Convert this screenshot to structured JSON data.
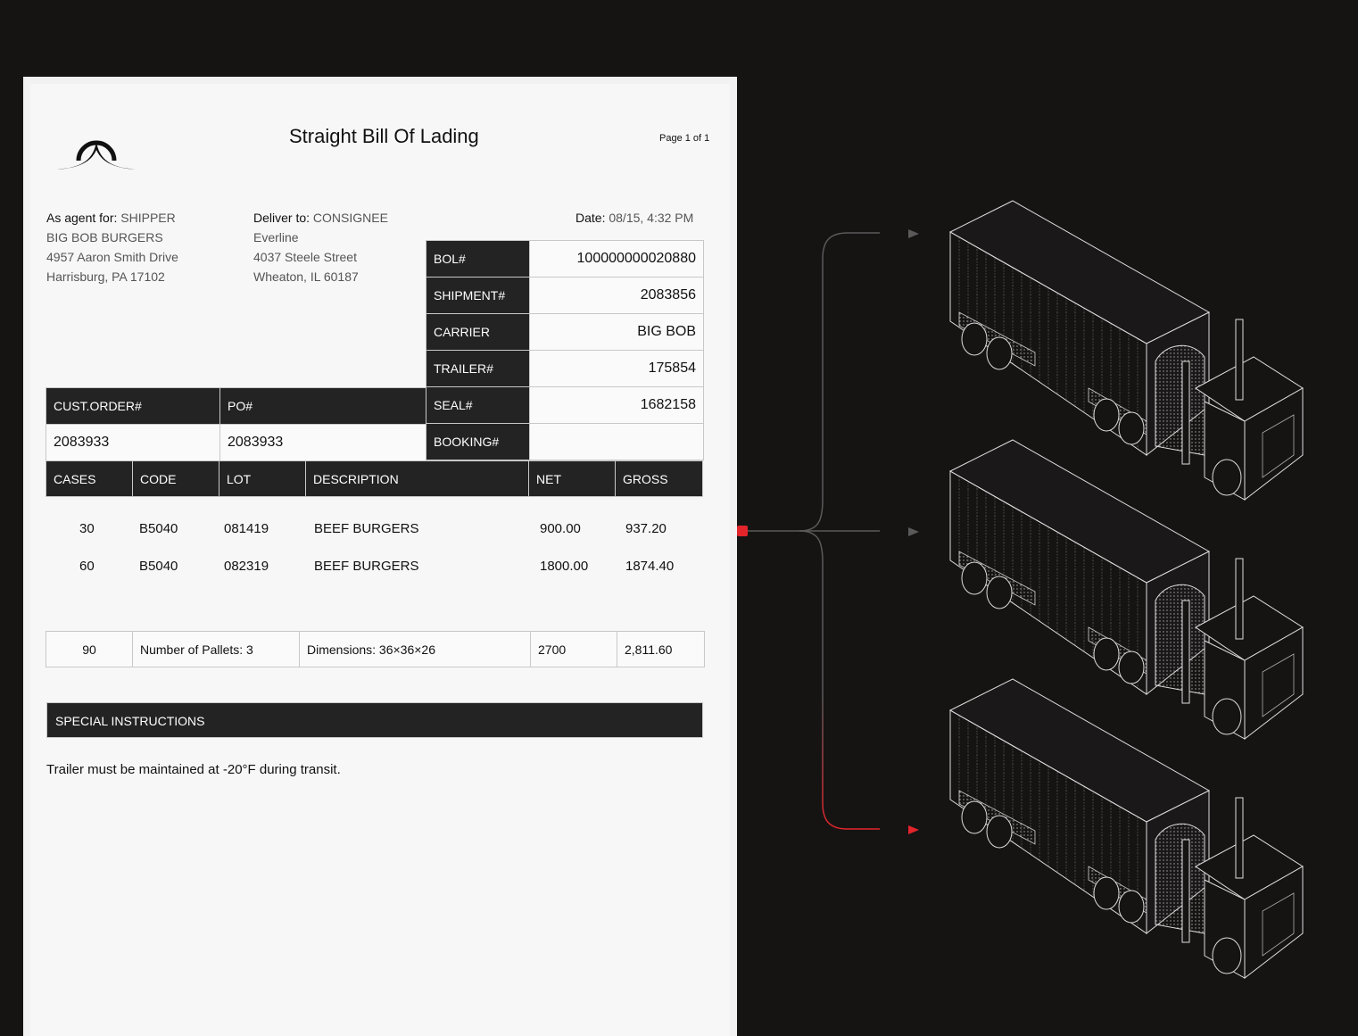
{
  "document": {
    "title": "Straight Bill Of Lading",
    "page": "Page 1 of 1",
    "shipper": {
      "label": "As agent for:",
      "role": "SHIPPER",
      "name": "BIG BOB BURGERS",
      "address1": "4957 Aaron Smith Drive",
      "address2": "Harrisburg, PA 17102"
    },
    "consignee": {
      "label": "Deliver to:",
      "role": "CONSIGNEE",
      "name": "Everline",
      "address1": "4037 Steele Street",
      "address2": "Wheaton, IL 60187"
    },
    "date": {
      "label": "Date:",
      "value": "08/15, 4:32 PM"
    },
    "refs": [
      {
        "label": "BOL#",
        "value": "100000000020880"
      },
      {
        "label": "SHIPMENT#",
        "value": "2083856"
      },
      {
        "label": "CARRIER",
        "value": "BIG BOB"
      },
      {
        "label": "TRAILER#",
        "value": "175854"
      },
      {
        "label": "SEAL#",
        "value": "1682158"
      },
      {
        "label": "BOOKING#",
        "value": ""
      }
    ],
    "order": {
      "cust_label": "CUST.ORDER#",
      "cust_value": "2083933",
      "po_label": "PO#",
      "po_value": "2083933"
    },
    "columns": [
      "CASES",
      "CODE",
      "LOT",
      "DESCRIPTION",
      "NET",
      "GROSS"
    ],
    "items": [
      {
        "cases": "30",
        "code": "B5040",
        "lot": "081419",
        "description": "BEEF BURGERS",
        "net": "900.00",
        "gross": "937.20"
      },
      {
        "cases": "60",
        "code": "B5040",
        "lot": "082319",
        "description": "BEEF BURGERS",
        "net": "1800.00",
        "gross": "1874.40"
      }
    ],
    "totals": {
      "cases": "90",
      "pallets": "Number of Pallets: 3",
      "dimensions": "Dimensions: 36×36×26",
      "net": "2700",
      "gross": "2,811.60"
    },
    "special_label": "SPECIAL INSTRUCTIONS",
    "special_text": "Trailer must be maintained at -20°F during transit."
  },
  "colors": {
    "background": "#161313",
    "paper": "#f7f7f7",
    "header_cell": "#232323",
    "accent": "#e3242b",
    "line": "#5a5a5a"
  },
  "icons": [
    "company-logo-icon",
    "connector-node-icon",
    "arrow-right-icon",
    "truck-illustration"
  ]
}
